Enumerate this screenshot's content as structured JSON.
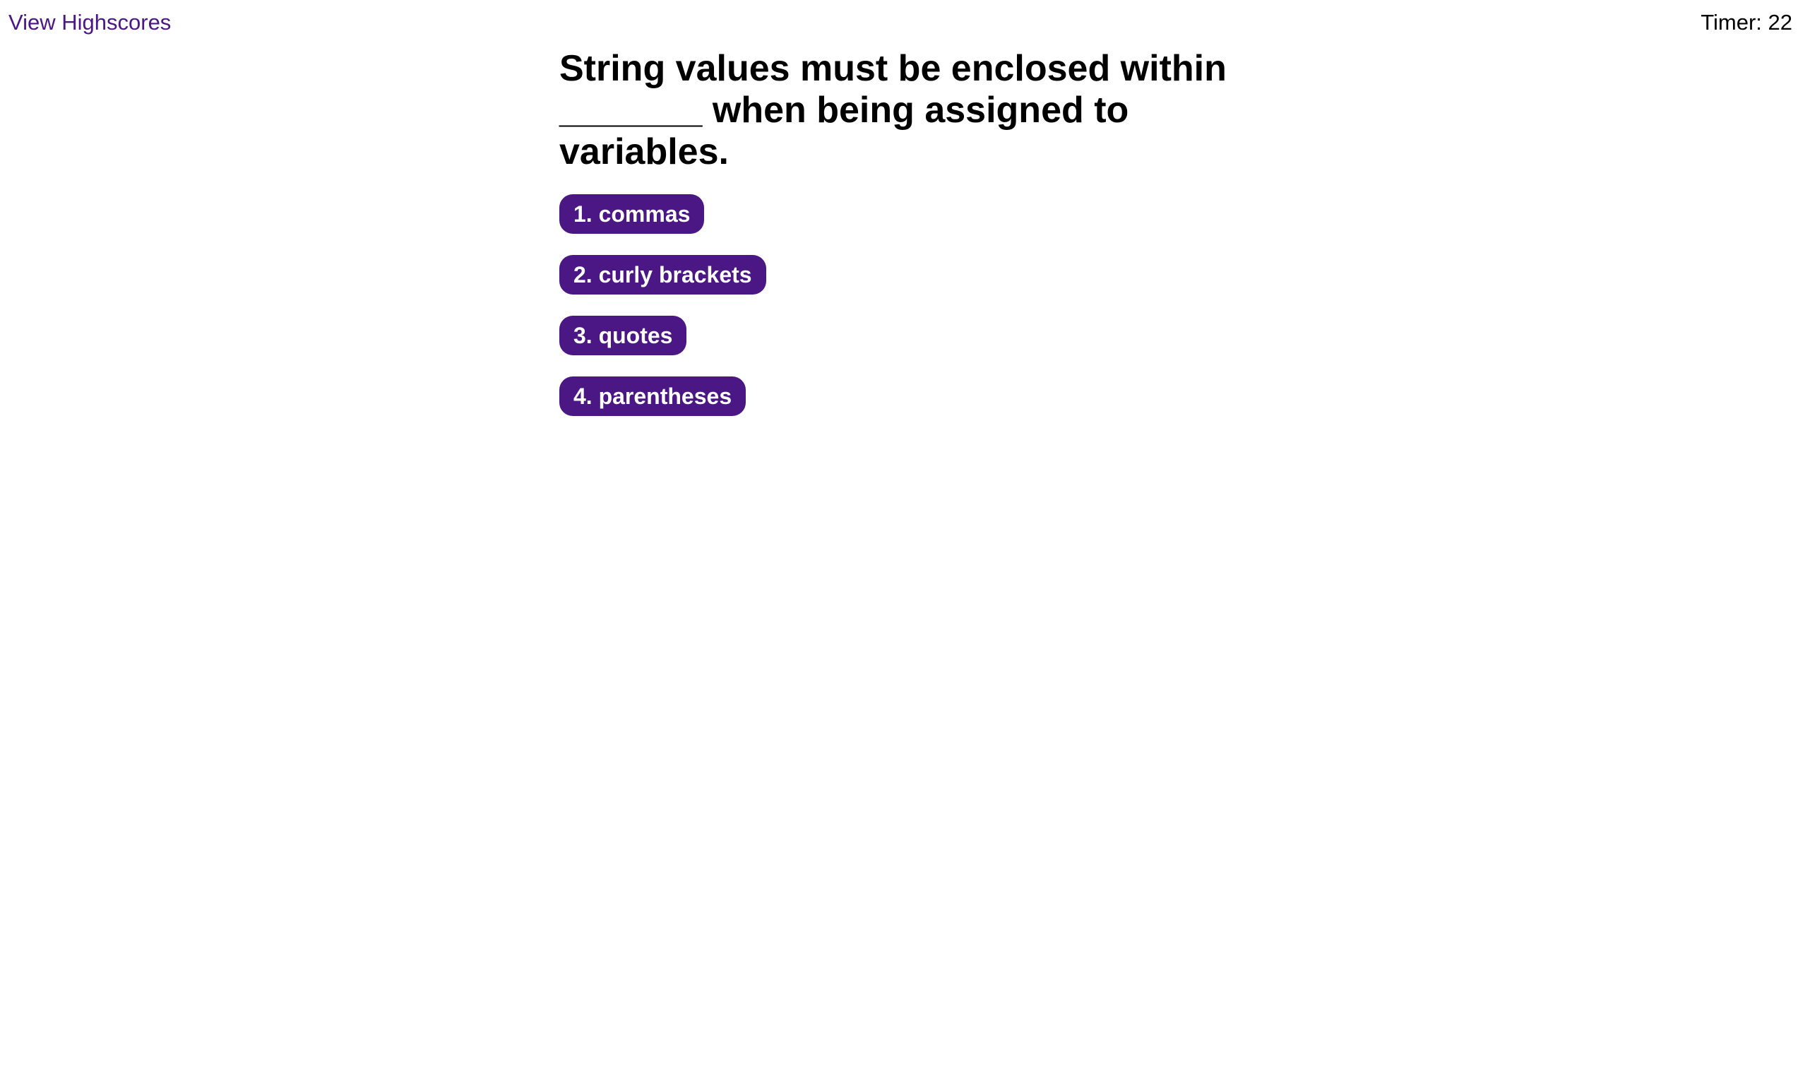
{
  "header": {
    "highscores_label": "View Highscores",
    "timer_text": "Timer: 22"
  },
  "quiz": {
    "question": "String values must be enclosed within _______ when being assigned to variables.",
    "choices": [
      {
        "label": "1. commas"
      },
      {
        "label": "2. curly brackets"
      },
      {
        "label": "3. quotes"
      },
      {
        "label": "4. parentheses"
      }
    ]
  },
  "colors": {
    "accent": "#4b1784",
    "button_text": "#ffffff",
    "text": "#000000",
    "background": "#ffffff"
  }
}
